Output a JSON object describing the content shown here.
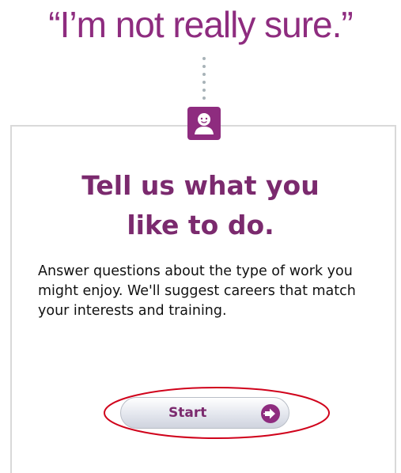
{
  "header": {
    "quote": "“I’m not really sure.”"
  },
  "card": {
    "heading_line1": "Tell us what you",
    "heading_line2": "like to do.",
    "description": "Answer questions about the type of work you might enjoy. We'll suggest careers that match your interests and training.",
    "start_label": "Start",
    "avatar_icon": "person-icon",
    "start_icon": "arrow-right-circle-icon"
  },
  "colors": {
    "brand_purple": "#8e2c7f",
    "heading_purple": "#7b2a6e",
    "highlight_red": "#d0021b"
  }
}
